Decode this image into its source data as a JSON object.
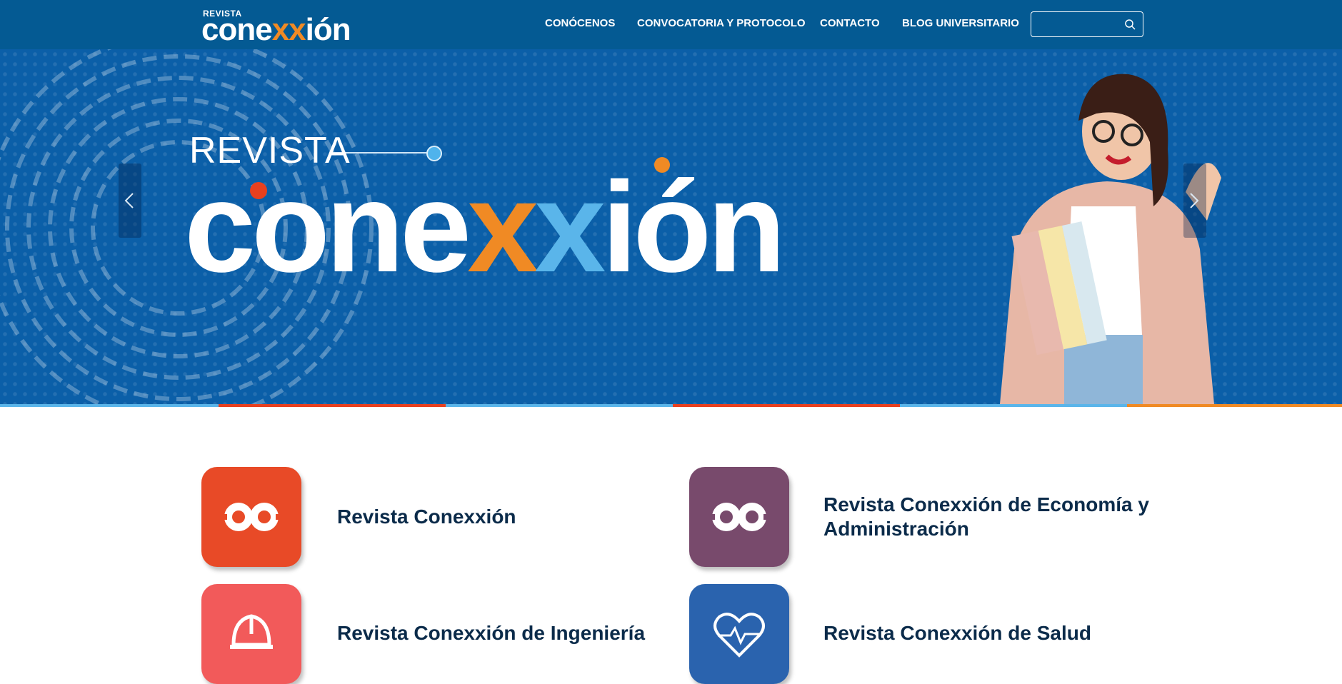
{
  "header": {
    "logo_small": "REVISTA",
    "logo_big_prefix": "cone",
    "logo_big_xx": "xx",
    "logo_big_suffix": "ión",
    "nav": [
      "CONÓCENOS",
      "CONVOCATORIA Y PROTOCOLO",
      "CONTACTO",
      "BLOG UNIVERSITARIO"
    ],
    "search": {
      "value": "",
      "placeholder": ""
    }
  },
  "hero": {
    "small_title": "REVISTA",
    "big_prefix": "cone",
    "big_x1": "x",
    "big_x2": "x",
    "big_suffix": "ión",
    "prev_icon": "chevron-left-icon",
    "next_icon": "chevron-right-icon"
  },
  "cards": [
    {
      "title": "Revista Conexxión",
      "color": "#e84a27",
      "icon": "conexxion-symbol-icon"
    },
    {
      "title": "Revista Conexxión de Economía y Administración",
      "color": "#784a6c",
      "icon": "conexxion-symbol-icon"
    },
    {
      "title": "Revista Conexxión de Ingeniería",
      "color": "#f25a5a",
      "icon": "hard-hat-icon"
    },
    {
      "title": "Revista Conexxión de Salud",
      "color": "#2a63ae",
      "icon": "heart-pulse-icon"
    }
  ],
  "colors": {
    "header_bg": "#045a93",
    "hero_bg": "#0b5fa8",
    "accent_orange": "#f08a24",
    "accent_red": "#e8401f",
    "accent_lightblue": "#5ab5ea"
  }
}
